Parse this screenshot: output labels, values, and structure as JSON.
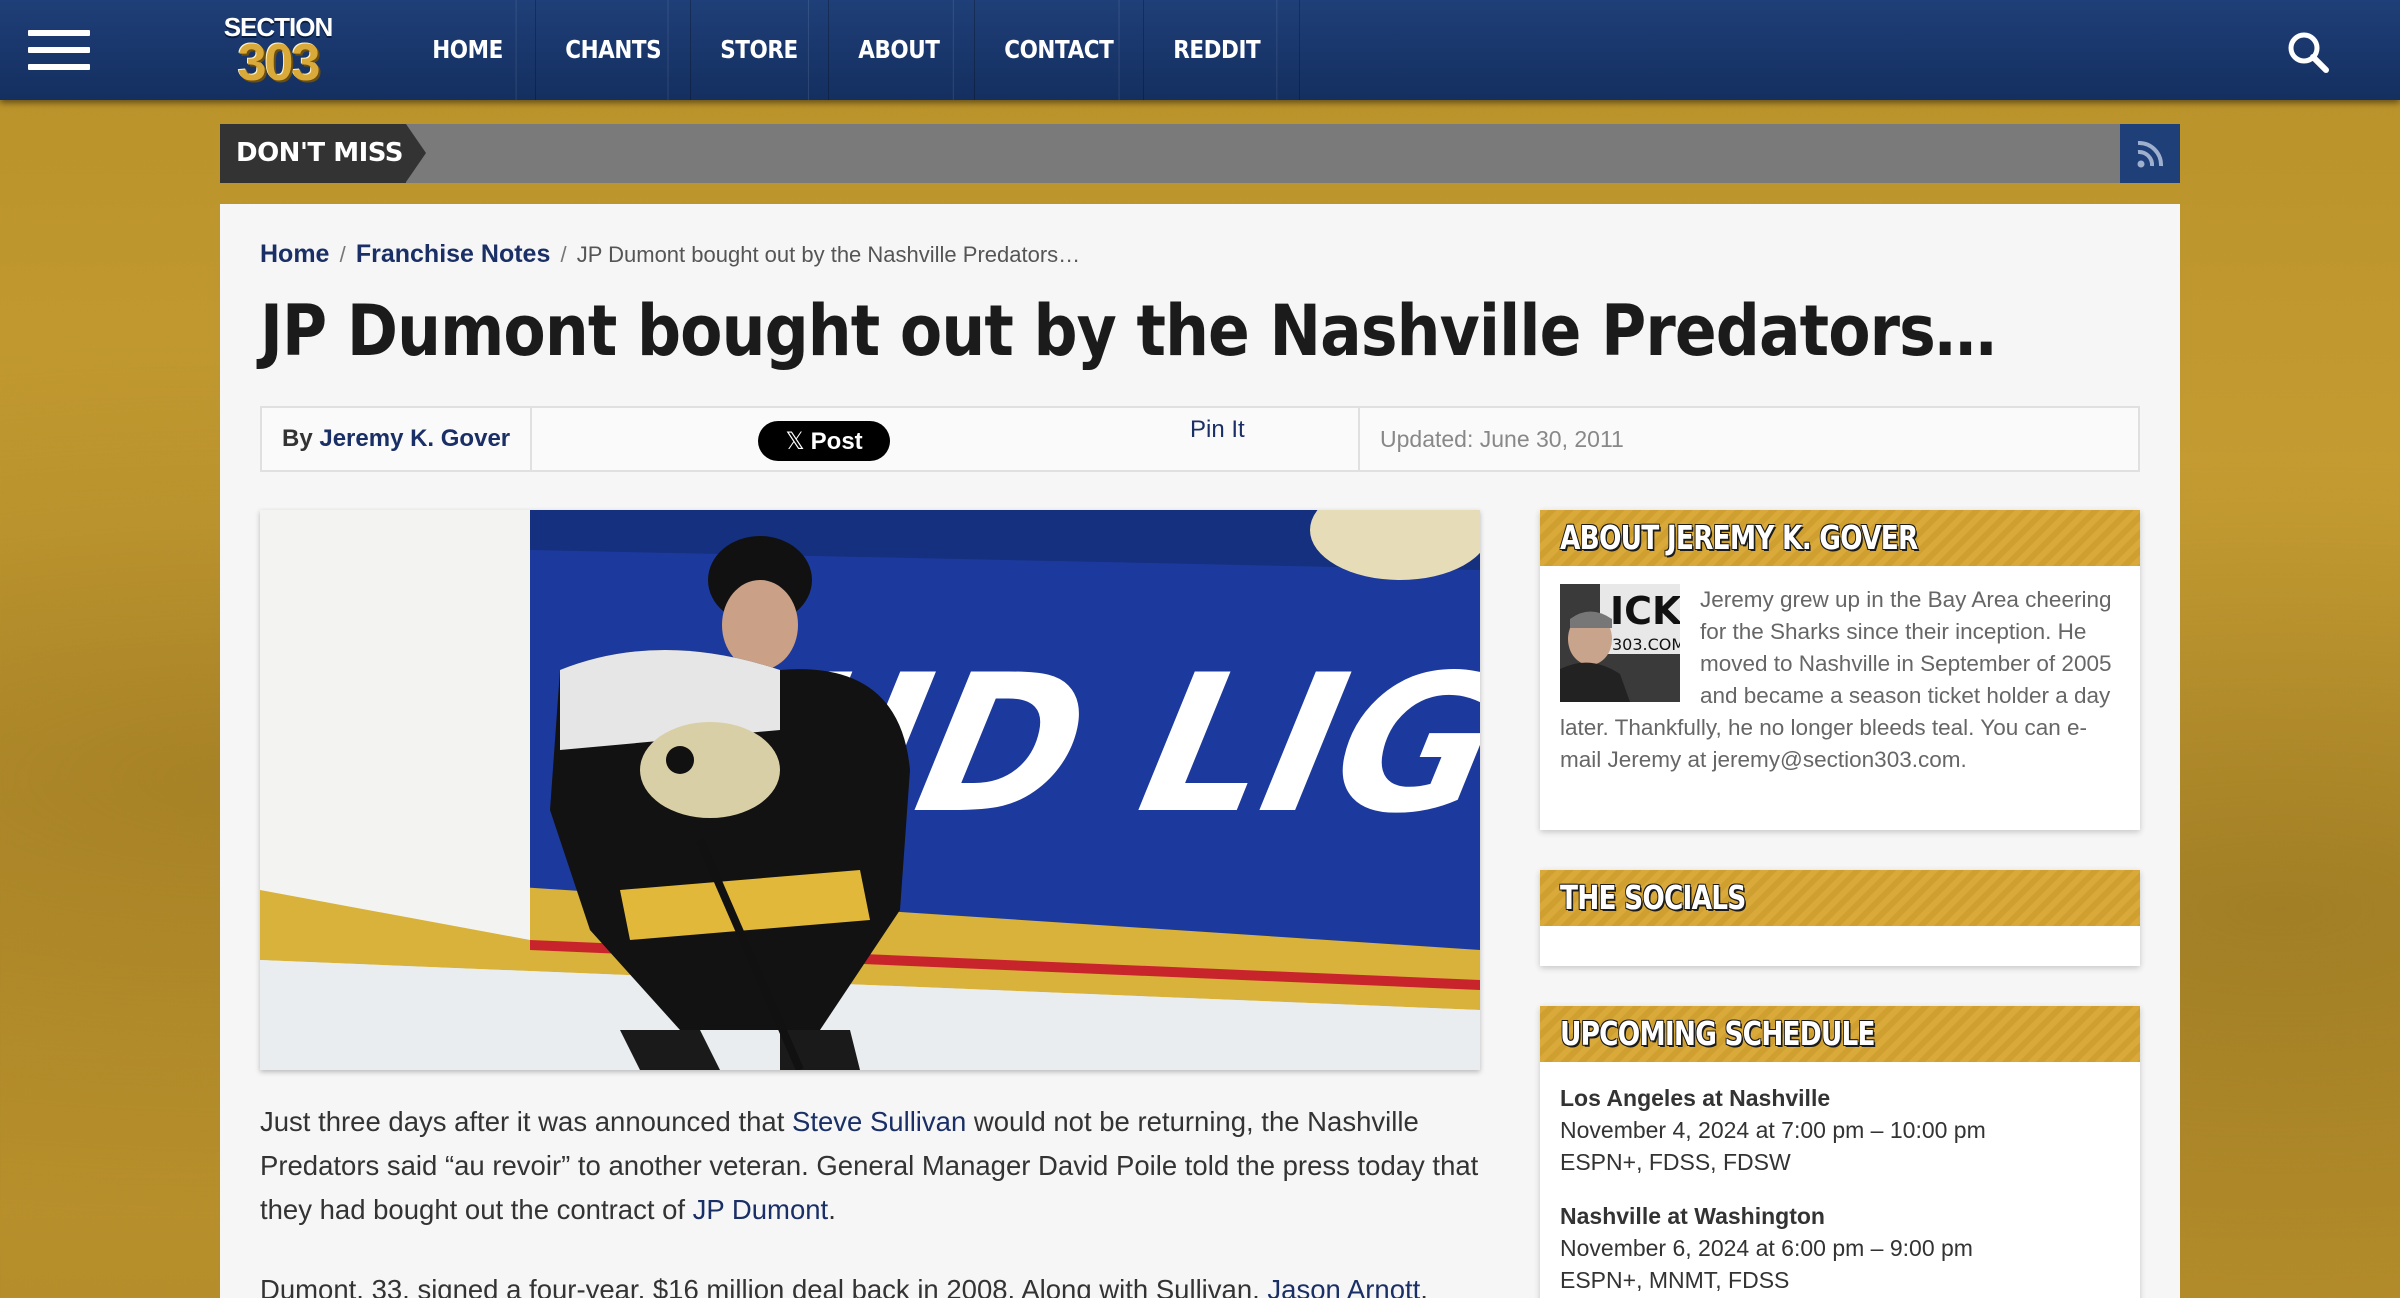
{
  "header": {
    "logo_top": "SECTION",
    "logo_bottom": "303",
    "nav": [
      "HOME",
      "CHANTS",
      "STORE",
      "ABOUT",
      "CONTACT",
      "REDDIT"
    ]
  },
  "ticker": {
    "label": "DON'T MISS"
  },
  "breadcrumb": {
    "home": "Home",
    "sep": "/",
    "category": "Franchise Notes",
    "current": "JP Dumont bought out by the Nashville Predators…"
  },
  "article": {
    "title": "JP Dumont bought out by the Nashville Predators…",
    "by_label": "By",
    "author": "Jeremy K. Gover",
    "post_label": "Post",
    "pin_label": "Pin It",
    "updated": "Updated: June 30, 2011",
    "p1": [
      "Just three days after it was announced that ",
      "Steve Sullivan",
      " would not be returning, the Nashville Predators said “au revoir” to another veteran. General Manager David Poile told the press today that they had bought out the contract of ",
      "JP Dumont",
      "."
    ],
    "p2": [
      "Dumont, 33, signed a four-year, $16 million deal back in 2008. Along with Sullivan, ",
      "Jason Arnott",
      ","
    ]
  },
  "sidebar": {
    "about_title": "ABOUT JEREMY K. GOVER",
    "about_text": "Jeremy grew up in the Bay Area cheering for the Sharks since their inception. He moved to Nashville in September of 2005 and became a season ticket holder a day later. Thankfully, he no longer bleeds teal. You can e-mail Jeremy at jeremy@section303.com.",
    "socials_title": "THE SOCIALS",
    "schedule_title": "UPCOMING SCHEDULE",
    "schedule": [
      {
        "teams": "Los Angeles at Nashville",
        "time": "November 4, 2024 at 7:00 pm – 10:00 pm",
        "tv": "ESPN+, FDSS, FDSW"
      },
      {
        "teams": "Nashville at Washington",
        "time": "November 6, 2024 at 6:00 pm – 9:00 pm",
        "tv": "ESPN+, MNMT, FDSS"
      }
    ]
  },
  "colors": {
    "navy": "#1a2f66",
    "gold": "#d9a93a"
  }
}
